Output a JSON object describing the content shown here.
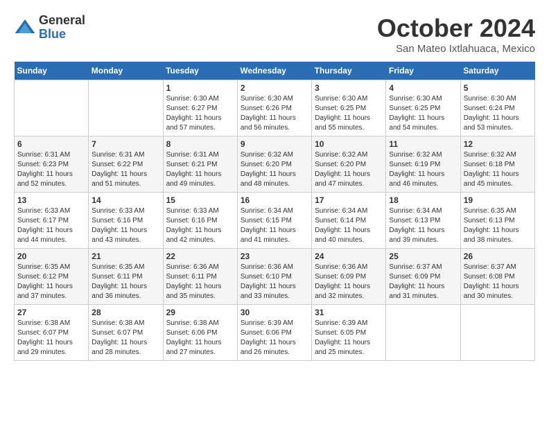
{
  "logo": {
    "general": "General",
    "blue": "Blue"
  },
  "title": "October 2024",
  "location": "San Mateo Ixtlahuaca, Mexico",
  "days_of_week": [
    "Sunday",
    "Monday",
    "Tuesday",
    "Wednesday",
    "Thursday",
    "Friday",
    "Saturday"
  ],
  "weeks": [
    [
      {
        "day": "",
        "sunrise": "",
        "sunset": "",
        "daylight": ""
      },
      {
        "day": "",
        "sunrise": "",
        "sunset": "",
        "daylight": ""
      },
      {
        "day": "1",
        "sunrise": "Sunrise: 6:30 AM",
        "sunset": "Sunset: 6:27 PM",
        "daylight": "Daylight: 11 hours and 57 minutes."
      },
      {
        "day": "2",
        "sunrise": "Sunrise: 6:30 AM",
        "sunset": "Sunset: 6:26 PM",
        "daylight": "Daylight: 11 hours and 56 minutes."
      },
      {
        "day": "3",
        "sunrise": "Sunrise: 6:30 AM",
        "sunset": "Sunset: 6:25 PM",
        "daylight": "Daylight: 11 hours and 55 minutes."
      },
      {
        "day": "4",
        "sunrise": "Sunrise: 6:30 AM",
        "sunset": "Sunset: 6:25 PM",
        "daylight": "Daylight: 11 hours and 54 minutes."
      },
      {
        "day": "5",
        "sunrise": "Sunrise: 6:30 AM",
        "sunset": "Sunset: 6:24 PM",
        "daylight": "Daylight: 11 hours and 53 minutes."
      }
    ],
    [
      {
        "day": "6",
        "sunrise": "Sunrise: 6:31 AM",
        "sunset": "Sunset: 6:23 PM",
        "daylight": "Daylight: 11 hours and 52 minutes."
      },
      {
        "day": "7",
        "sunrise": "Sunrise: 6:31 AM",
        "sunset": "Sunset: 6:22 PM",
        "daylight": "Daylight: 11 hours and 51 minutes."
      },
      {
        "day": "8",
        "sunrise": "Sunrise: 6:31 AM",
        "sunset": "Sunset: 6:21 PM",
        "daylight": "Daylight: 11 hours and 49 minutes."
      },
      {
        "day": "9",
        "sunrise": "Sunrise: 6:32 AM",
        "sunset": "Sunset: 6:20 PM",
        "daylight": "Daylight: 11 hours and 48 minutes."
      },
      {
        "day": "10",
        "sunrise": "Sunrise: 6:32 AM",
        "sunset": "Sunset: 6:20 PM",
        "daylight": "Daylight: 11 hours and 47 minutes."
      },
      {
        "day": "11",
        "sunrise": "Sunrise: 6:32 AM",
        "sunset": "Sunset: 6:19 PM",
        "daylight": "Daylight: 11 hours and 46 minutes."
      },
      {
        "day": "12",
        "sunrise": "Sunrise: 6:32 AM",
        "sunset": "Sunset: 6:18 PM",
        "daylight": "Daylight: 11 hours and 45 minutes."
      }
    ],
    [
      {
        "day": "13",
        "sunrise": "Sunrise: 6:33 AM",
        "sunset": "Sunset: 6:17 PM",
        "daylight": "Daylight: 11 hours and 44 minutes."
      },
      {
        "day": "14",
        "sunrise": "Sunrise: 6:33 AM",
        "sunset": "Sunset: 6:16 PM",
        "daylight": "Daylight: 11 hours and 43 minutes."
      },
      {
        "day": "15",
        "sunrise": "Sunrise: 6:33 AM",
        "sunset": "Sunset: 6:16 PM",
        "daylight": "Daylight: 11 hours and 42 minutes."
      },
      {
        "day": "16",
        "sunrise": "Sunrise: 6:34 AM",
        "sunset": "Sunset: 6:15 PM",
        "daylight": "Daylight: 11 hours and 41 minutes."
      },
      {
        "day": "17",
        "sunrise": "Sunrise: 6:34 AM",
        "sunset": "Sunset: 6:14 PM",
        "daylight": "Daylight: 11 hours and 40 minutes."
      },
      {
        "day": "18",
        "sunrise": "Sunrise: 6:34 AM",
        "sunset": "Sunset: 6:13 PM",
        "daylight": "Daylight: 11 hours and 39 minutes."
      },
      {
        "day": "19",
        "sunrise": "Sunrise: 6:35 AM",
        "sunset": "Sunset: 6:13 PM",
        "daylight": "Daylight: 11 hours and 38 minutes."
      }
    ],
    [
      {
        "day": "20",
        "sunrise": "Sunrise: 6:35 AM",
        "sunset": "Sunset: 6:12 PM",
        "daylight": "Daylight: 11 hours and 37 minutes."
      },
      {
        "day": "21",
        "sunrise": "Sunrise: 6:35 AM",
        "sunset": "Sunset: 6:11 PM",
        "daylight": "Daylight: 11 hours and 36 minutes."
      },
      {
        "day": "22",
        "sunrise": "Sunrise: 6:36 AM",
        "sunset": "Sunset: 6:11 PM",
        "daylight": "Daylight: 11 hours and 35 minutes."
      },
      {
        "day": "23",
        "sunrise": "Sunrise: 6:36 AM",
        "sunset": "Sunset: 6:10 PM",
        "daylight": "Daylight: 11 hours and 33 minutes."
      },
      {
        "day": "24",
        "sunrise": "Sunrise: 6:36 AM",
        "sunset": "Sunset: 6:09 PM",
        "daylight": "Daylight: 11 hours and 32 minutes."
      },
      {
        "day": "25",
        "sunrise": "Sunrise: 6:37 AM",
        "sunset": "Sunset: 6:09 PM",
        "daylight": "Daylight: 11 hours and 31 minutes."
      },
      {
        "day": "26",
        "sunrise": "Sunrise: 6:37 AM",
        "sunset": "Sunset: 6:08 PM",
        "daylight": "Daylight: 11 hours and 30 minutes."
      }
    ],
    [
      {
        "day": "27",
        "sunrise": "Sunrise: 6:38 AM",
        "sunset": "Sunset: 6:07 PM",
        "daylight": "Daylight: 11 hours and 29 minutes."
      },
      {
        "day": "28",
        "sunrise": "Sunrise: 6:38 AM",
        "sunset": "Sunset: 6:07 PM",
        "daylight": "Daylight: 11 hours and 28 minutes."
      },
      {
        "day": "29",
        "sunrise": "Sunrise: 6:38 AM",
        "sunset": "Sunset: 6:06 PM",
        "daylight": "Daylight: 11 hours and 27 minutes."
      },
      {
        "day": "30",
        "sunrise": "Sunrise: 6:39 AM",
        "sunset": "Sunset: 6:06 PM",
        "daylight": "Daylight: 11 hours and 26 minutes."
      },
      {
        "day": "31",
        "sunrise": "Sunrise: 6:39 AM",
        "sunset": "Sunset: 6:05 PM",
        "daylight": "Daylight: 11 hours and 25 minutes."
      },
      {
        "day": "",
        "sunrise": "",
        "sunset": "",
        "daylight": ""
      },
      {
        "day": "",
        "sunrise": "",
        "sunset": "",
        "daylight": ""
      }
    ]
  ]
}
